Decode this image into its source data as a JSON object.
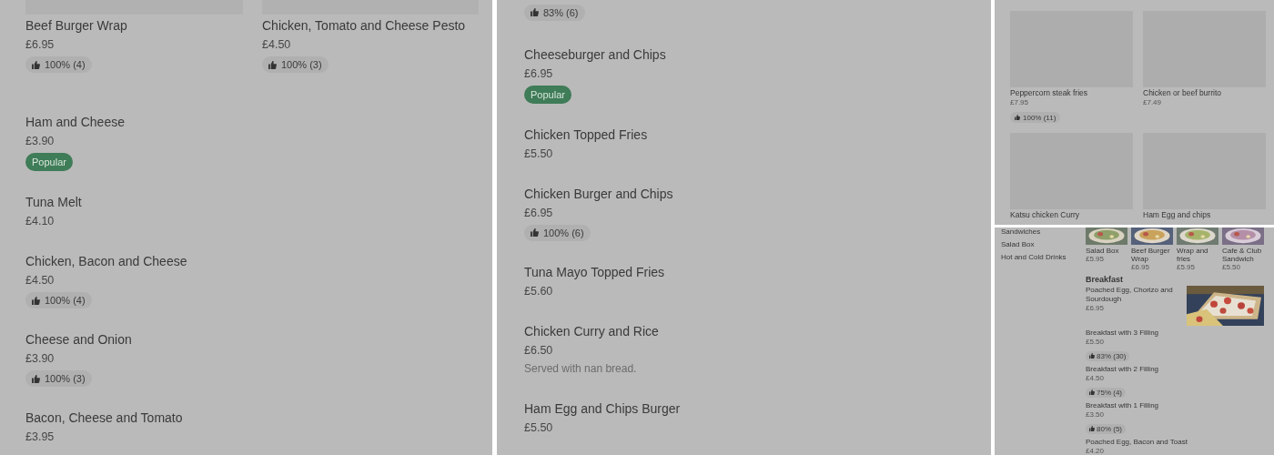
{
  "left_panel": {
    "grid": [
      {
        "name": "Beef Burger Wrap",
        "price": "£6.95",
        "rating": "100% (4)"
      },
      {
        "name": "Chicken, Tomato and Cheese Pesto",
        "price": "£4.50",
        "rating": "100% (3)"
      }
    ],
    "items": [
      {
        "name": "Ham and Cheese",
        "price": "£3.90",
        "badge": "Popular"
      },
      {
        "name": "Tuna Melt",
        "price": "£4.10"
      },
      {
        "name": "Chicken, Bacon and Cheese",
        "price": "£4.50",
        "rating": "100% (4)"
      },
      {
        "name": "Cheese and Onion",
        "price": "£3.90",
        "rating": "100% (3)"
      },
      {
        "name": "Bacon, Cheese and Tomato",
        "price": "£3.95"
      }
    ]
  },
  "middle_panel": {
    "top_rating": "83% (6)",
    "items": [
      {
        "name": "Cheeseburger and Chips",
        "price": "£6.95",
        "badge": "Popular"
      },
      {
        "name": "Chicken Topped Fries",
        "price": "£5.50"
      },
      {
        "name": "Chicken Burger and Chips",
        "price": "£6.95",
        "rating": "100% (6)"
      },
      {
        "name": "Tuna Mayo Topped Fries",
        "price": "£5.60"
      },
      {
        "name": "Chicken Curry and Rice",
        "price": "£6.50",
        "note": "Served with nan bread."
      },
      {
        "name": "Ham Egg and Chips Burger",
        "price": "£5.50"
      }
    ]
  },
  "right_top_panel": {
    "items": [
      {
        "name": "Peppercorn steak fries",
        "price": "£7.95",
        "rating": "100% (11)"
      },
      {
        "name": "Chicken or beef burrito",
        "price": "£7.49"
      },
      {
        "name": "Katsu chicken Curry"
      },
      {
        "name": "Ham Egg and chips"
      }
    ]
  },
  "right_bottom_panel": {
    "categories": [
      "Sandwiches",
      "Salad Box",
      "Hot and Cold Drinks"
    ],
    "tiles": [
      {
        "name": "Salad Box",
        "price": "£5.95"
      },
      {
        "name": "Beef Burger Wrap",
        "price": "£6.95"
      },
      {
        "name": "Wrap and fries",
        "price": "£5.95"
      },
      {
        "name": "Cafe & Club Sandwich",
        "price": "£5.50"
      }
    ],
    "section_title": "Breakfast",
    "featured": {
      "name": "Poached Egg, Chorizo and Sourdough",
      "price": "£6.95"
    },
    "items": [
      {
        "name": "Breakfast with 3 Filling",
        "price": "£5.50",
        "rating": "83% (30)"
      },
      {
        "name": "Breakfast with 2 Filling",
        "price": "£4.50",
        "rating": "75% (4)"
      },
      {
        "name": "Breakfast with 1 Filling",
        "price": "£3.50",
        "rating": "80% (5)"
      },
      {
        "name": "Poached Egg, Bacon and Toast",
        "price": "£4.20"
      }
    ]
  }
}
